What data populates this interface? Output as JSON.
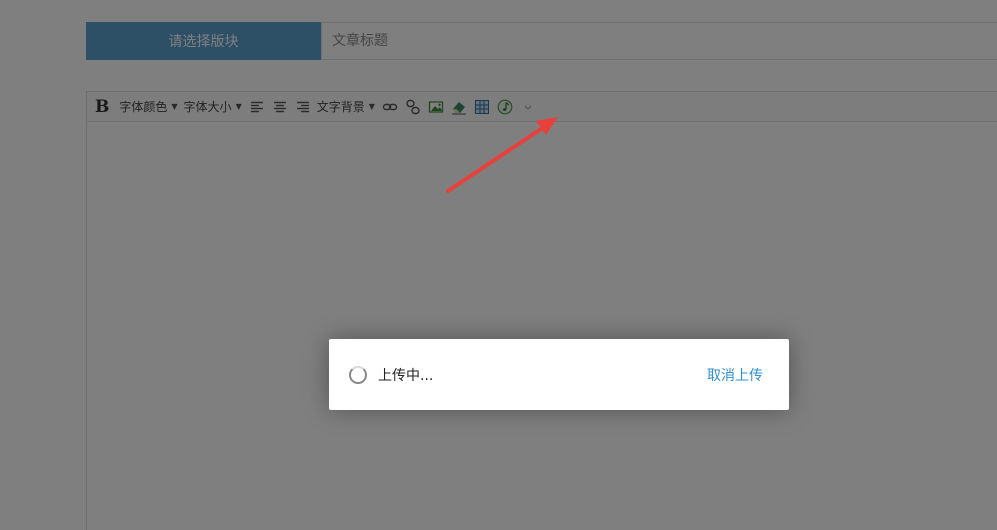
{
  "header": {
    "board_select_label": "请选择版块",
    "title_placeholder": "文章标题"
  },
  "toolbar": {
    "bold_label": "B",
    "font_color_label": "字体颜色",
    "font_size_label": "字体大小",
    "text_bg_label": "文字背景",
    "dropdown_caret": "▼"
  },
  "dialog": {
    "status_text": "上传中...",
    "cancel_label": "取消上传"
  },
  "colors": {
    "board_select_bg": "#5aa0ce",
    "cancel_link": "#2d92d4",
    "annotation_arrow": "#e8403a"
  },
  "icons": [
    "align-left-icon",
    "align-center-icon",
    "align-right-icon",
    "link-icon",
    "unlink-icon",
    "image-icon",
    "eraser-icon",
    "table-icon",
    "music-icon",
    "more-icon",
    "spinner-icon"
  ]
}
